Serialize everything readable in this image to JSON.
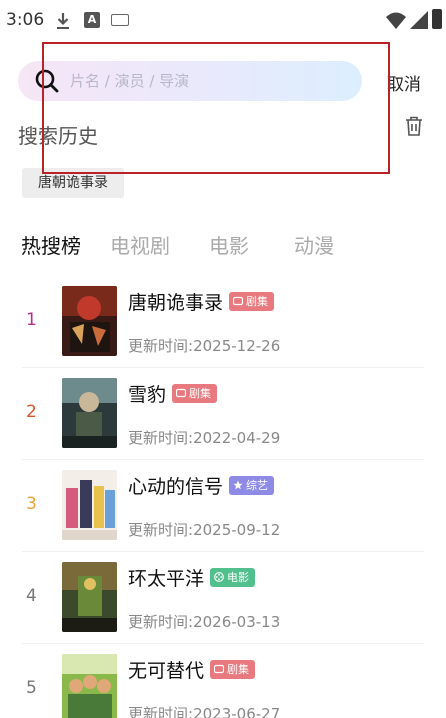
{
  "status_bar": {
    "time": "3:06",
    "icons": [
      "download-icon",
      "a-notification-icon",
      "keyboard-icon",
      "wifi-icon",
      "signal-icon",
      "battery-icon"
    ]
  },
  "search": {
    "placeholder": "片名 / 演员 / 导演",
    "value": "",
    "cancel_label": "取消"
  },
  "history": {
    "title": "搜索历史",
    "items": [
      "唐朝诡事录"
    ]
  },
  "tabs": [
    {
      "label": "热搜榜",
      "active": true
    },
    {
      "label": "电视剧",
      "active": false
    },
    {
      "label": "电影",
      "active": false
    },
    {
      "label": "动漫",
      "active": false
    }
  ],
  "rankings": [
    {
      "rank": "1",
      "title": "唐朝诡事录",
      "badge": "剧集",
      "update_label": "更新时间:",
      "date": "2025-12-26"
    },
    {
      "rank": "2",
      "title": "雪豹",
      "badge": "剧集",
      "update_label": "更新时间:",
      "date": "2022-04-29"
    },
    {
      "rank": "3",
      "title": "心动的信号",
      "badge": "综艺",
      "update_label": "更新时间:",
      "date": "2025-09-12"
    },
    {
      "rank": "4",
      "title": "环太平洋",
      "badge": "电影",
      "update_label": "更新时间:",
      "date": "2026-03-13"
    },
    {
      "rank": "5",
      "title": "无可替代",
      "badge": "剧集",
      "update_label": "更新时间:",
      "date": "2023-06-27"
    }
  ],
  "colors": {
    "rank_1": "#b0338a",
    "rank_2": "#d8542e",
    "rank_3": "#e6a336",
    "rank_other": "#777777",
    "badge_series": "#e8797f",
    "badge_variety": "#8e8be6",
    "badge_movie": "#52c08c",
    "selection_outline": "#b8232a"
  }
}
